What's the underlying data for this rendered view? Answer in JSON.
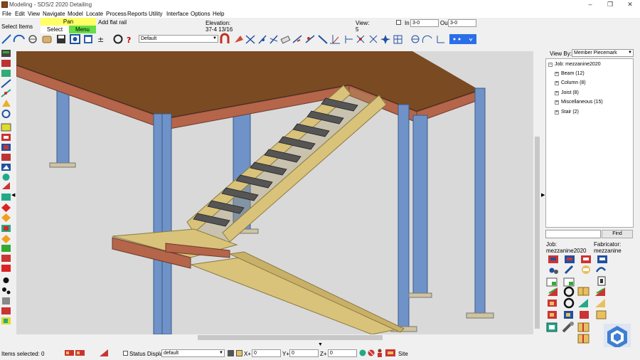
{
  "window": {
    "title": "Modeling - SDS/2 2020 Detailing"
  },
  "menubar": {
    "items": [
      "File",
      "Edit",
      "View",
      "Navigate",
      "Model",
      "Locate",
      "Process",
      "Reports",
      "Utility",
      "Interface",
      "Options",
      "Help"
    ]
  },
  "toolbar": {
    "select_items_label": "Select Items",
    "pan_label": "Pan",
    "select_label": "Select",
    "menu_label": "Menu",
    "add_flat_rail": "Add flat rail",
    "elevation_label": "Elevation:",
    "elevation_value": "37-4 13/16",
    "view_label": "View:",
    "view_value": "5",
    "in_label": "In",
    "in_value": "3-0",
    "out_label": "Out",
    "out_value": "3-0",
    "default_combo": "Default"
  },
  "right_panel": {
    "view_by_label": "View By:",
    "view_by_value": "Member Piecemark",
    "tree_root": "Job: mezzanine2020",
    "tree_items": [
      "Beam (12)",
      "Column (8)",
      "Joist (8)",
      "Miscellaneous (15)",
      "Stair (2)"
    ],
    "find_label": "Find",
    "job_label": "Job:",
    "job_value": "mezzanine2020",
    "fabricator_label": "Fabricator:",
    "fabricator_value": "mezzanine"
  },
  "statusbar": {
    "items_selected": "Items selected: 0",
    "status_display": "Status Display",
    "status_combo": "default",
    "x_label": "X+",
    "x_value": "0",
    "y_label": "Y+",
    "y_value": "0",
    "z_label": "Z+",
    "z_value": "0",
    "site_label": "Site"
  },
  "colors": {
    "beam": "#b5654a",
    "column": "#6f93c8",
    "stair": "#d9c27a",
    "deck": "#7a4a22",
    "yellow": "#ffff66",
    "green": "#66dd44"
  }
}
